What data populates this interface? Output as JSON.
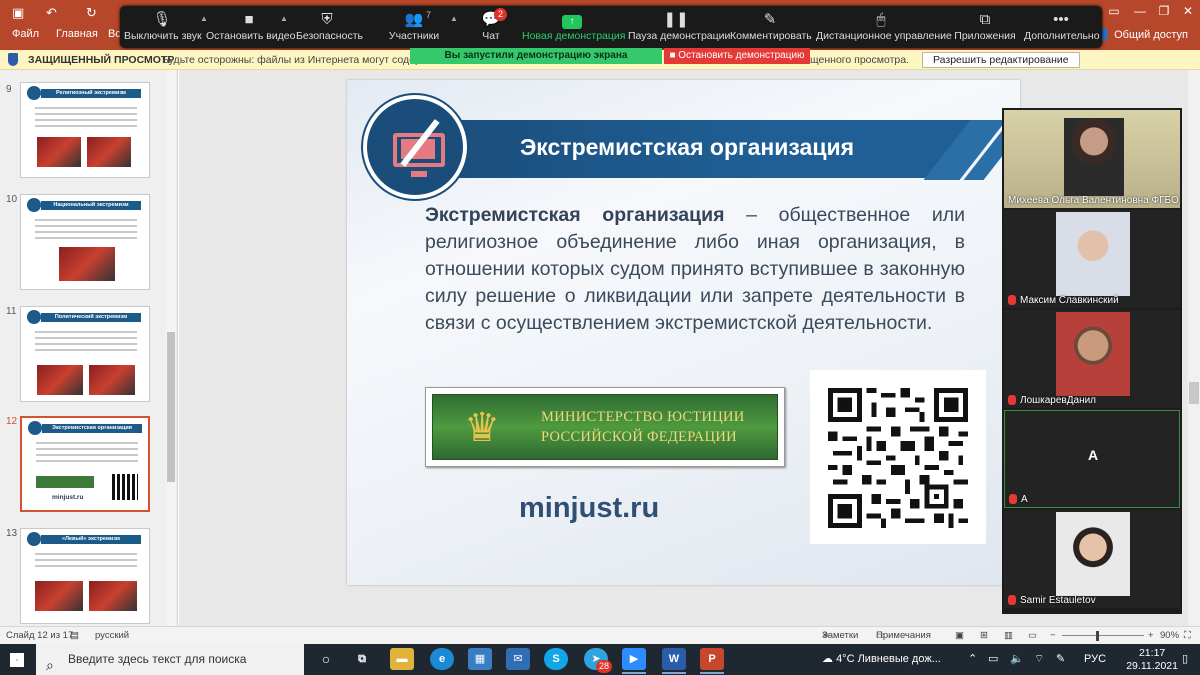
{
  "ppt": {
    "menus": [
      "Файл",
      "Главная",
      "Вс"
    ],
    "share": "Общий доступ",
    "protected_title": "ЗАЩИЩЕННЫЙ ПРОСМОТР",
    "protected_msg": "Будьте осторожны: файлы из Интернета могут содержат",
    "protected_msg2": "щенного просмотра.",
    "enable_editing": "Разрешить редактирование"
  },
  "zoom": {
    "buttons": [
      {
        "label": "Выключить звук",
        "icon": "mic-icon"
      },
      {
        "label": "Остановить видео",
        "icon": "video-icon"
      },
      {
        "label": "Безопасность",
        "icon": "shield-icon"
      },
      {
        "label": "Участники",
        "icon": "participants-icon"
      },
      {
        "label": "Чат",
        "icon": "chat-icon"
      },
      {
        "label": "Новая демонстрация",
        "icon": "share-screen-icon"
      },
      {
        "label": "Пауза демонстрации",
        "icon": "pause-icon"
      },
      {
        "label": "Комментировать",
        "icon": "pen-icon"
      },
      {
        "label": "Дистанционное управление",
        "icon": "mouse-icon"
      },
      {
        "label": "Приложения",
        "icon": "apps-icon"
      },
      {
        "label": "Дополнительно",
        "icon": "more-icon"
      }
    ],
    "participants_count": "7",
    "chat_badge": "2",
    "sharing_banner": "Вы запустили демонстрацию экрана",
    "stop_share": "Остановить демонстрацию",
    "participants": [
      {
        "name": "Михеева Ольга Валентиновна ФГБО..."
      },
      {
        "name": "Максим Славкинский"
      },
      {
        "name": "ЛошкаревДанил"
      },
      {
        "name": "A",
        "avatar": "A"
      },
      {
        "name": "Samir Estauletov"
      }
    ]
  },
  "thumbnails": [
    {
      "num": "9",
      "title": "Религиозный экстремизм"
    },
    {
      "num": "10",
      "title": "Национальный экстремизм"
    },
    {
      "num": "11",
      "title": "Политический экстремизм"
    },
    {
      "num": "12",
      "title": "Экстремистская организация",
      "site": "minjust.ru"
    },
    {
      "num": "13",
      "title": "«Левый» экстремизм"
    }
  ],
  "slide": {
    "title": "Экстремистская организация",
    "term": "Экстремистская организация",
    "definition": " – общественное или религиозное объединение либо иная организация, в отношении которых судом принято вступившее в законную силу решение о ликвидации или запрете деятельности в связи с осуществлением экстремистской деятельности.",
    "logo_line1": "МИНИСТЕРСТВО ЮСТИЦИИ",
    "logo_line2": "РОССИЙСКОЙ ФЕДЕРАЦИИ",
    "site": "minjust.ru"
  },
  "status": {
    "slide": "Слайд 12 из 17",
    "lang": "русский",
    "notes": "Заметки",
    "comments": "Примечания",
    "zoom": "90%"
  },
  "taskbar": {
    "search_placeholder": "Введите здесь текст для поиска",
    "weather": "4°C  Ливневые дож...",
    "lang": "РУС",
    "time": "21:17",
    "date": "29.11.2021",
    "ppt_badge": "28"
  }
}
